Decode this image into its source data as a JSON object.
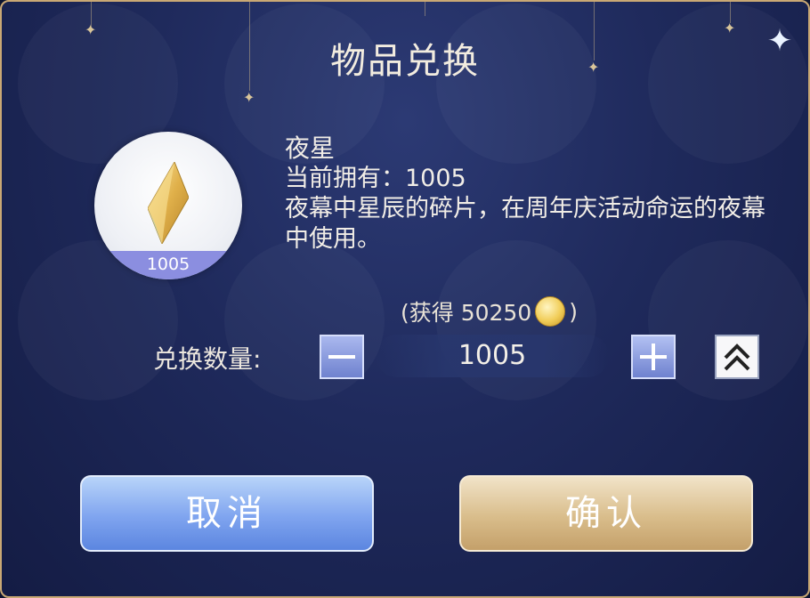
{
  "dialog": {
    "title": "物品兑换",
    "close_icon": "close-star-icon"
  },
  "item": {
    "name": "夜星",
    "owned_label": "当前拥有：1005",
    "description": "夜幕中星辰的碎片，在周年庆活动命运的夜幕中使用。",
    "count_badge": "1005",
    "icon": "crystal-shard-icon"
  },
  "reward": {
    "open": "(获得 50250",
    "close": ")",
    "icon": "gold-coin-icon"
  },
  "quantity": {
    "label": "兑换数量:",
    "value": "1005",
    "minus_icon": "minus-icon",
    "plus_icon": "plus-icon",
    "max_icon": "double-chevron-up-icon"
  },
  "buttons": {
    "cancel_label": "取消",
    "confirm_label": "确认"
  },
  "colors": {
    "border": "#c9a874",
    "panel": "#1f2a5c",
    "cancel": "#7fa4ef",
    "confirm": "#d9bd8b"
  }
}
